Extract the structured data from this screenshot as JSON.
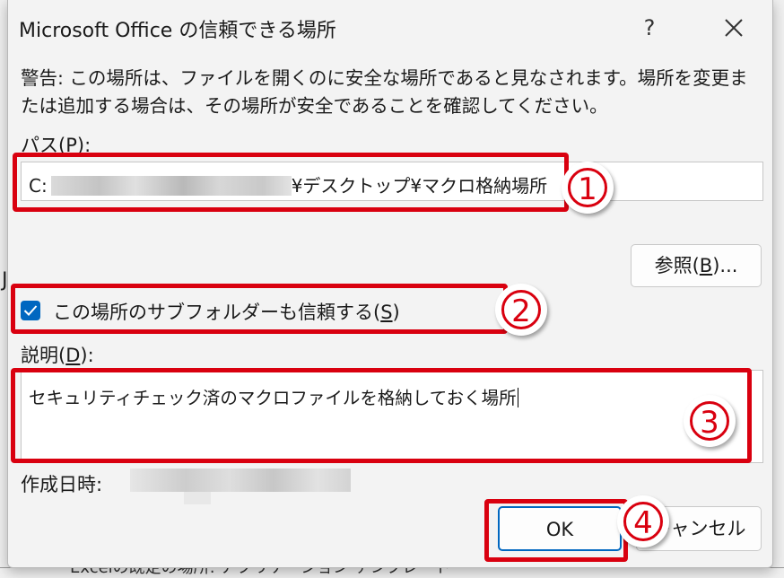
{
  "background": {
    "frag_dots_1": "…",
    "frag_ellipsis": "…",
    "frag_bottom": "Excelの既定の場所: アプリケーション テンプレート"
  },
  "dialog": {
    "title": "Microsoft Office の信頼できる場所",
    "help_label": "?",
    "warning": "警告: この場所は、ファイルを開くのに安全な場所であると見なされます。場所を変更または追加する場合は、その場所が安全であることを確認してください。",
    "path_label_pre": "パス(",
    "path_label_key": "P",
    "path_label_post": "):",
    "path_prefix": "C:",
    "path_suffix": "¥デスクトップ¥マクロ格納場所",
    "browse_pre": "参照(",
    "browse_key": "B",
    "browse_post": ")...",
    "subfolder_checked": true,
    "subfolder_pre": "この場所のサブフォルダーも信頼する(",
    "subfolder_key": "S",
    "subfolder_post": ")",
    "desc_label_pre": "説明(",
    "desc_label_key": "D",
    "desc_label_post": "):",
    "description": "セキュリティチェック済のマクロファイルを格納しておく場所",
    "created_label": "作成日時:",
    "ok_label": "OK",
    "cancel_label": "キャンセル"
  },
  "annotations": {
    "badge_1": "1",
    "badge_2": "2",
    "badge_3": "3",
    "badge_4": "4",
    "color": "#d9000f"
  },
  "colors": {
    "accent": "#0067c0",
    "annotation_red": "#d9000f"
  }
}
